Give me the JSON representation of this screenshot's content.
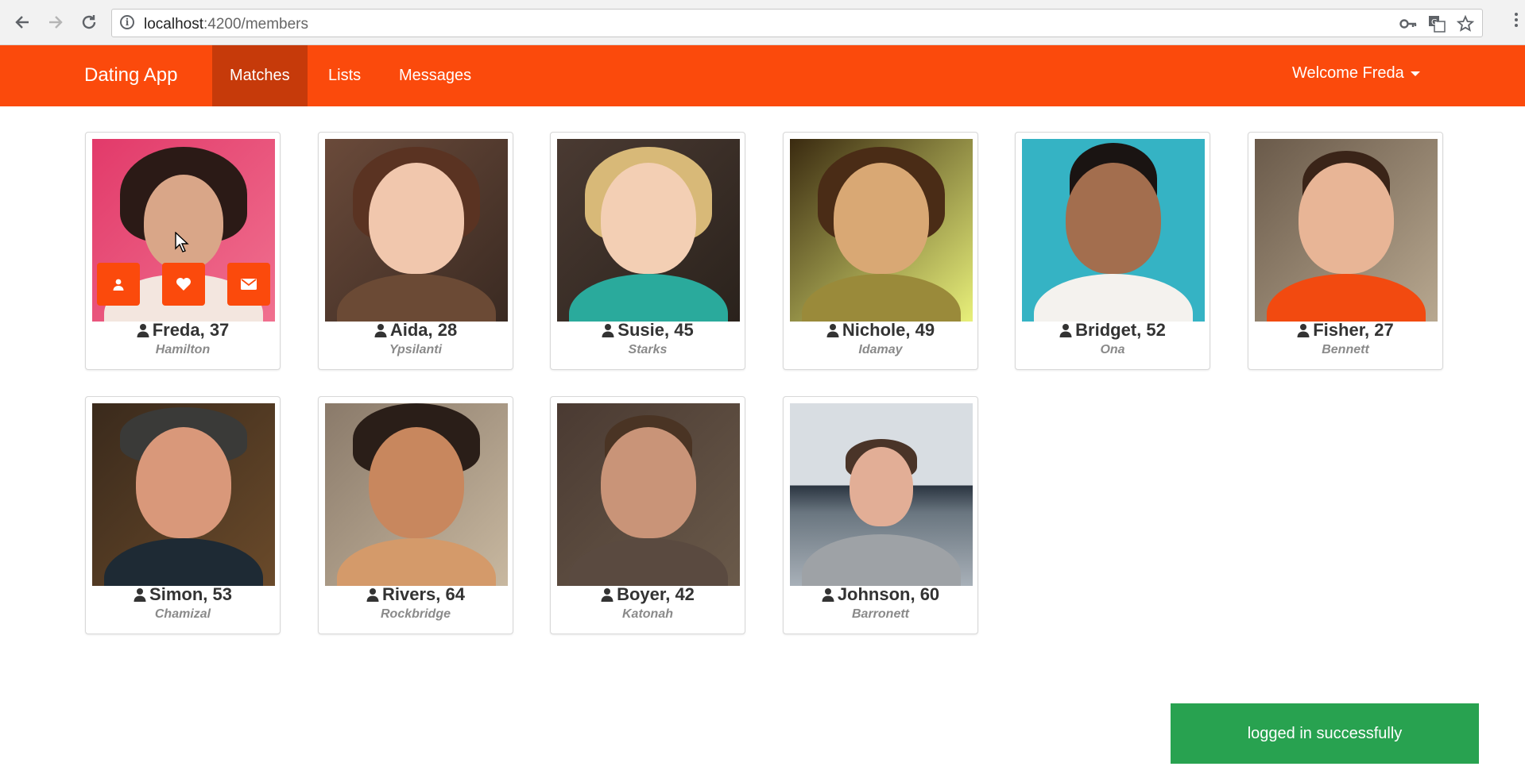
{
  "browser": {
    "url_host": "localhost",
    "url_rest": ":4200/members",
    "back_icon": "arrow-left-icon",
    "forward_icon": "arrow-right-icon",
    "reload_icon": "reload-icon"
  },
  "navbar": {
    "brand": "Dating App",
    "items": [
      "Matches",
      "Lists",
      "Messages"
    ],
    "active": "Matches",
    "welcome": "Welcome Freda",
    "color": "#fb4a0c"
  },
  "members": [
    {
      "name": "Freda, 37",
      "city": "Hamilton"
    },
    {
      "name": "Aida, 28",
      "city": "Ypsilanti"
    },
    {
      "name": "Susie, 45",
      "city": "Starks"
    },
    {
      "name": "Nichole, 49",
      "city": "Idamay"
    },
    {
      "name": "Bridget, 52",
      "city": "Ona"
    },
    {
      "name": "Fisher, 27",
      "city": "Bennett"
    },
    {
      "name": "Simon, 53",
      "city": "Chamizal"
    },
    {
      "name": "Rivers, 64",
      "city": "Rockbridge"
    },
    {
      "name": "Boyer, 42",
      "city": "Katonah"
    },
    {
      "name": "Johnson, 60",
      "city": "Barronett"
    }
  ],
  "card_actions": [
    "user-icon",
    "heart-icon",
    "envelope-icon"
  ],
  "toast": {
    "text": "logged in successfully",
    "color": "#28a250"
  }
}
